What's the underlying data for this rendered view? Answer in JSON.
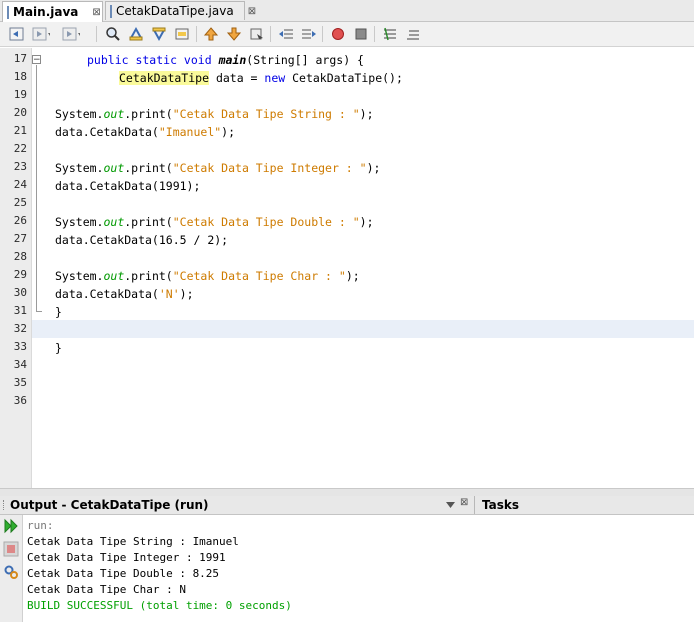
{
  "tabs": [
    {
      "label": "Main.java",
      "close": "⊠",
      "active": true
    },
    {
      "label": "CetakDataTipe.java",
      "close": "⊠",
      "active": false
    }
  ],
  "toolbar_icons": [
    "back-icon",
    "forward-icon",
    "search-icon",
    "find-prev-icon",
    "find-next-icon",
    "toggle-highlight-icon",
    "prev-bookmark-icon",
    "next-bookmark-icon",
    "toggle-bookmark-icon",
    "shift-left-icon",
    "shift-right-icon",
    "record-macro-icon",
    "stop-macro-icon",
    "comment-icon",
    "uncomment-icon"
  ],
  "editor": {
    "line_numbers": [
      "17",
      "18",
      "19",
      "20",
      "21",
      "22",
      "23",
      "24",
      "25",
      "26",
      "27",
      "28",
      "29",
      "30",
      "31",
      "32",
      "33",
      "34",
      "35",
      "36"
    ],
    "code": {
      "l17": {
        "kw1": "public static void ",
        "method": "main",
        "rest": "(String[] args) {"
      },
      "l18": {
        "type": "CetakDataTipe",
        "mid": " data = ",
        "kw": "new",
        "rest": " CetakDataTipe();"
      },
      "l20": {
        "a": "System.",
        "field": "out",
        "b": ".print(",
        "str": "\"Cetak Data Tipe String : \"",
        "c": ");"
      },
      "l21": {
        "a": "data.CetakData(",
        "str": "\"Imanuel\"",
        "c": ");"
      },
      "l23": {
        "a": "System.",
        "field": "out",
        "b": ".print(",
        "str": "\"Cetak Data Tipe Integer : \"",
        "c": ");"
      },
      "l24": {
        "text": "data.CetakData(1991);"
      },
      "l26": {
        "a": "System.",
        "field": "out",
        "b": ".print(",
        "str": "\"Cetak Data Tipe Double : \"",
        "c": ");"
      },
      "l27": {
        "text": "data.CetakData(16.5 / 2);"
      },
      "l29": {
        "a": "System.",
        "field": "out",
        "b": ".print(",
        "str": "\"Cetak Data Tipe Char : \"",
        "c": ");"
      },
      "l30": {
        "a": "data.CetakData(",
        "str": "'N'",
        "c": ");"
      },
      "l31": {
        "text": "}"
      },
      "l33": {
        "text": "}"
      }
    }
  },
  "output": {
    "title": "Output - CetakDataTipe (run)",
    "tasks_title": "Tasks",
    "lines": [
      {
        "text": "run:"
      },
      {
        "text": "Cetak Data Tipe String : Imanuel"
      },
      {
        "text": "Cetak Data Tipe Integer : 1991"
      },
      {
        "text": "Cetak Data Tipe Double : 8.25"
      },
      {
        "text": "Cetak Data Tipe Char : N"
      },
      {
        "text": "BUILD SUCCESSFUL (total time: 0 seconds)"
      }
    ]
  }
}
